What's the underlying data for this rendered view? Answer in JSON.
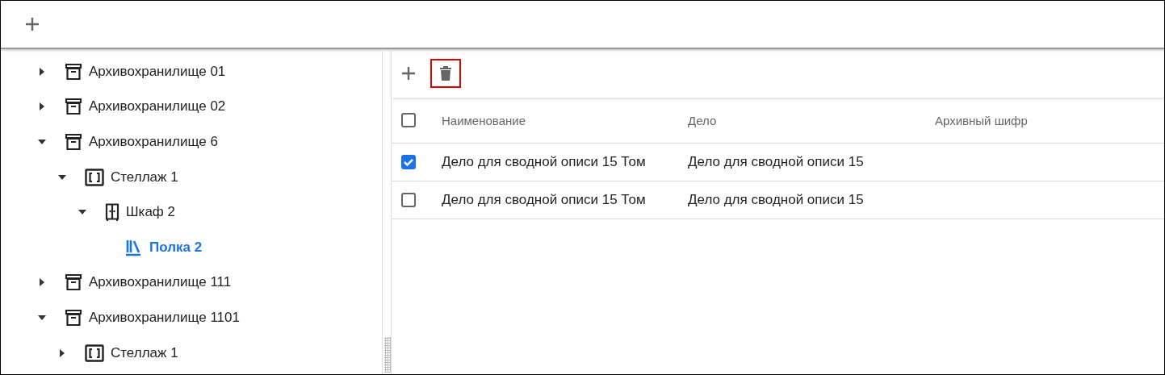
{
  "top_toolbar": {
    "buttons": [
      {
        "kind": "add"
      }
    ]
  },
  "tree": [
    {
      "label": "Архивохранилище 01",
      "kind": "storage",
      "expanded": false,
      "selected": false
    },
    {
      "label": "Архивохранилище 02",
      "kind": "storage",
      "expanded": false,
      "selected": false
    },
    {
      "label": "Архивохранилище 6",
      "kind": "storage",
      "expanded": true,
      "selected": false,
      "children": [
        {
          "label": "Стеллаж 1",
          "kind": "rack",
          "expanded": true,
          "selected": false,
          "children": [
            {
              "label": "Шкаф 2",
              "kind": "cabinet",
              "expanded": true,
              "selected": false,
              "children": [
                {
                  "label": "Полка 2",
                  "kind": "shelf",
                  "selected": true
                }
              ]
            }
          ]
        }
      ]
    },
    {
      "label": "Архивохранилище 111",
      "kind": "storage",
      "expanded": false,
      "selected": false
    },
    {
      "label": "Архивохранилище 1101",
      "kind": "storage",
      "expanded": true,
      "selected": false,
      "children": [
        {
          "label": "Стеллаж 1",
          "kind": "rack",
          "expanded": false,
          "selected": false
        }
      ]
    }
  ],
  "list_toolbar": {
    "buttons": [
      {
        "kind": "add",
        "highlighted": false
      },
      {
        "kind": "delete",
        "highlighted": true
      }
    ]
  },
  "table": {
    "all_checked": false,
    "columns": [
      "Наименование",
      "Дело",
      "Архивный шифр"
    ],
    "rows": [
      {
        "checked": true,
        "cells": [
          "Дело для сводной описи 15 Том",
          "Дело для сводной описи 15",
          ""
        ]
      },
      {
        "checked": false,
        "cells": [
          "Дело для сводной описи 15 Том",
          "Дело для сводной описи 15",
          ""
        ]
      }
    ]
  }
}
